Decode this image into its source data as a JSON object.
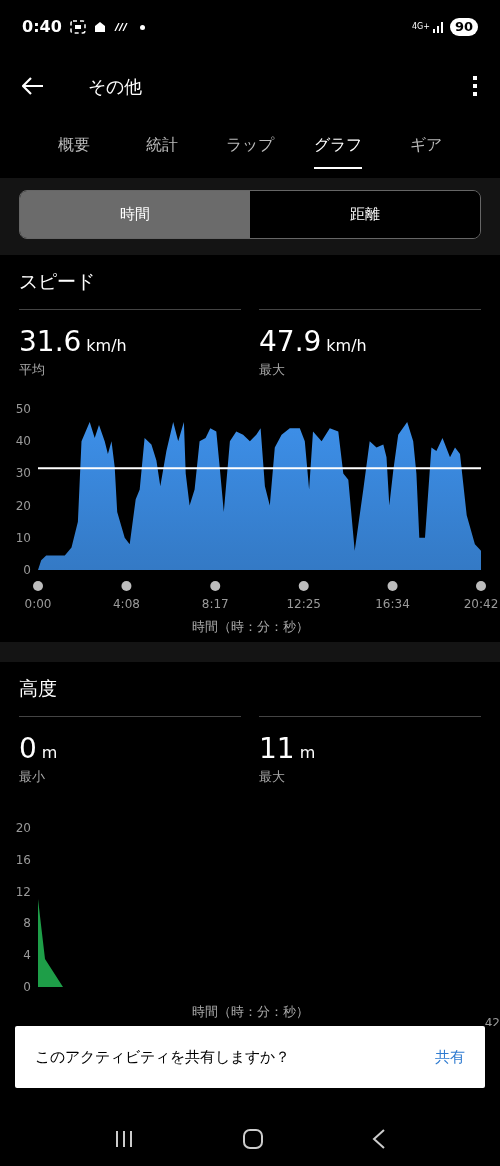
{
  "status_bar": {
    "time": "0:40",
    "battery": "90",
    "network": "4G+"
  },
  "header": {
    "title": "その他"
  },
  "tabs": [
    {
      "label": "概要",
      "selected": false
    },
    {
      "label": "統計",
      "selected": false
    },
    {
      "label": "ラップ",
      "selected": false
    },
    {
      "label": "グラフ",
      "selected": true
    },
    {
      "label": "ギア",
      "selected": false
    }
  ],
  "segments": [
    {
      "label": "時間",
      "selected": true
    },
    {
      "label": "距離",
      "selected": false
    }
  ],
  "sections": [
    {
      "title": "スピード",
      "stats": [
        {
          "value": "31.6",
          "unit": "km/h",
          "label": "平均"
        },
        {
          "value": "47.9",
          "unit": "km/h",
          "label": "最大"
        }
      ],
      "chart_data": {
        "type": "area",
        "xlabel": "時間（時：分：秒）",
        "x": [
          0,
          9,
          23,
          75,
          94,
          112,
          122,
          145,
          159,
          171,
          187,
          196,
          206,
          215,
          222,
          243,
          257,
          274,
          285,
          299,
          318,
          332,
          343,
          360,
          379,
          393,
          409,
          414,
          425,
          439,
          453,
          470,
          483,
          500,
          511,
          521,
          538,
          556,
          575,
          594,
          612,
          624,
          636,
          650,
          664,
          683,
          706,
          734,
          748,
          760,
          771,
          795,
          818,
          842,
          856,
          870,
          888,
          912,
          930,
          949,
          968,
          977,
          985,
          996,
          1010,
          1035,
          1052,
          1061,
          1069,
          1085,
          1103,
          1117,
          1134,
          1155,
          1169,
          1183,
          1202,
          1225,
          1242
        ],
        "series": [
          {
            "color": "#3d8fe8",
            "values": [
              0,
              3,
              4.5,
              4.5,
              7,
              15,
              40,
              46,
              41,
              45,
              40,
              36,
              40,
              32,
              18,
              10,
              8,
              22,
              25,
              41,
              39,
              34,
              26,
              37,
              46,
              40,
              46,
              30,
              20,
              25,
              40,
              41,
              44,
              43,
              30,
              18,
              40,
              43,
              42,
              40,
              42,
              44,
              26,
              20,
              38,
              42,
              44,
              44,
              40,
              25,
              43,
              40,
              44,
              43,
              30,
              28,
              6,
              25,
              40,
              38,
              39,
              35,
              20,
              31,
              42,
              46,
              40,
              30,
              10,
              10,
              38,
              37,
              41,
              35,
              38,
              36,
              17,
              8,
              6
            ]
          }
        ],
        "xlim": [
          0,
          1242
        ],
        "ylim": [
          0,
          50
        ],
        "yticks": [
          0,
          10,
          20,
          30,
          40,
          50
        ],
        "xticks": [
          {
            "value": 0,
            "label": "0:00"
          },
          {
            "value": 248,
            "label": "4:08"
          },
          {
            "value": 497,
            "label": "8:17"
          },
          {
            "value": 745,
            "label": "12:25"
          },
          {
            "value": 994,
            "label": "16:34"
          },
          {
            "value": 1242,
            "label": "20:42"
          }
        ],
        "ref_lines": [
          {
            "axis": "y",
            "value": 31.6
          }
        ]
      }
    },
    {
      "title": "高度",
      "stats": [
        {
          "value": "0",
          "unit": "m",
          "label": "最小"
        },
        {
          "value": "11",
          "unit": "m",
          "label": "最大"
        }
      ],
      "graph": {
        "axis_title": "時間（時：分：秒）",
        "y_labels": [
          "20",
          "16",
          "12",
          "8",
          "4",
          "0"
        ],
        "x_label_fragment": "42"
      }
    }
  ],
  "snackbar": {
    "message": "このアクティビティを共有しますか？",
    "action": "共有"
  }
}
